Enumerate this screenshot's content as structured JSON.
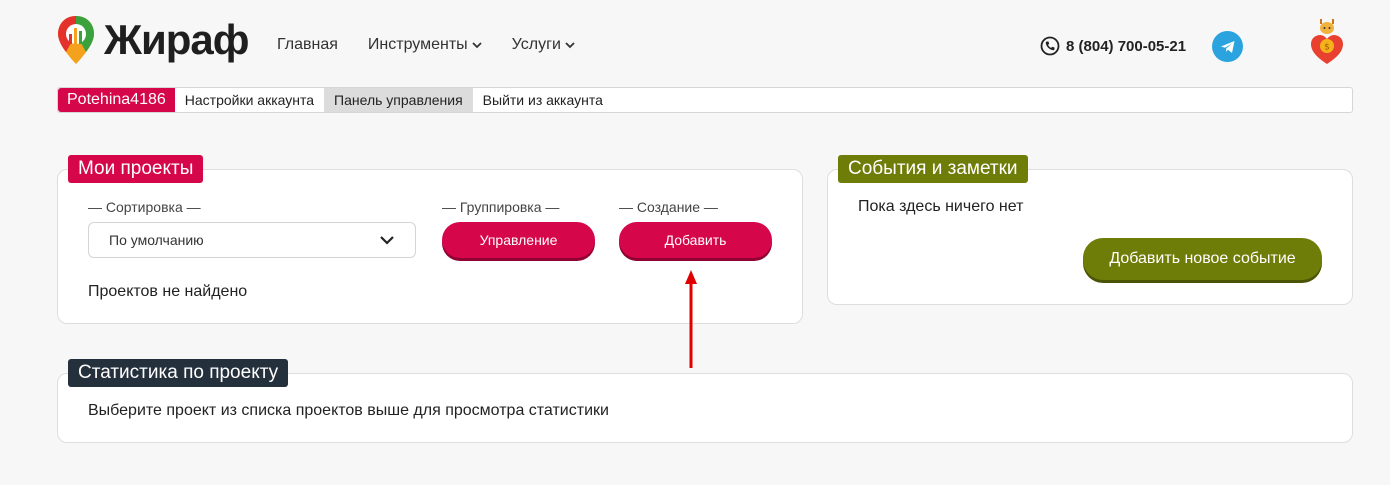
{
  "header": {
    "logo_text": "Жираф",
    "nav": [
      {
        "label": "Главная",
        "dropdown": false
      },
      {
        "label": "Инструменты",
        "dropdown": true
      },
      {
        "label": "Услуги",
        "dropdown": true
      }
    ],
    "phone": "8 (804) 700-05-21"
  },
  "account_bar": {
    "username": "Potehina4186",
    "items": [
      "Настройки аккаунта",
      "Панель управления",
      "Выйти из аккаунта"
    ],
    "active_index": 1
  },
  "projects": {
    "title": "Мои проекты",
    "sort_label": "— Сортировка —",
    "sort_value": "По умолчанию",
    "group_label": "— Группировка —",
    "manage_button": "Управление",
    "create_label": "— Создание —",
    "add_button": "Добавить",
    "empty_text": "Проектов не найдено"
  },
  "events": {
    "title": "События и заметки",
    "empty_text": "Пока здесь ничего нет",
    "add_button": "Добавить новое событие"
  },
  "stats": {
    "title": "Статистика по проекту",
    "hint": "Выберите проект из списка проектов выше для просмотра статистики"
  },
  "colors": {
    "brand": "#d6064b",
    "olive": "#6e7d08",
    "dark": "#25303d",
    "telegram": "#2aa3df",
    "annotation_arrow": "#e00000"
  }
}
